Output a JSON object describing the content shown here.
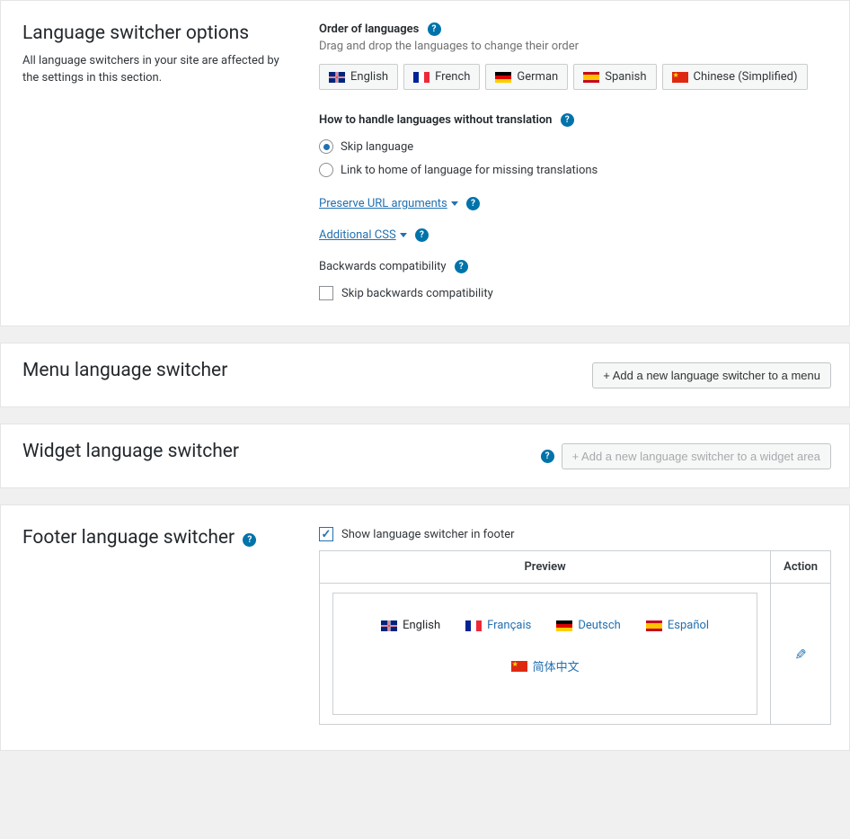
{
  "section1": {
    "title": "Language switcher options",
    "desc": "All language switchers in your site are affected by the settings in this section.",
    "order_label": "Order of languages",
    "order_sub": "Drag and drop the languages to change their order",
    "languages": [
      {
        "name": "English",
        "flag": "gb"
      },
      {
        "name": "French",
        "flag": "fr"
      },
      {
        "name": "German",
        "flag": "de"
      },
      {
        "name": "Spanish",
        "flag": "es"
      },
      {
        "name": "Chinese (Simplified)",
        "flag": "cn"
      }
    ],
    "missing_label": "How to handle languages without translation",
    "radio1": "Skip language",
    "radio2": "Link to home of language for missing translations",
    "preserve_url": "Preserve URL arguments",
    "additional_css": "Additional CSS",
    "back_compat": "Backwards compatibility",
    "skip_back_compat": "Skip backwards compatibility"
  },
  "section2": {
    "title": "Menu language switcher",
    "button": "+ Add a new language switcher to a menu"
  },
  "section3": {
    "title": "Widget language switcher",
    "button": "+ Add a new language switcher to a widget area"
  },
  "section4": {
    "title": "Footer language switcher",
    "checkbox": "Show language switcher in footer",
    "preview_header": "Preview",
    "action_header": "Action",
    "preview_langs": [
      {
        "name": "English",
        "flag": "gb",
        "current": true
      },
      {
        "name": "Français",
        "flag": "fr",
        "current": false
      },
      {
        "name": "Deutsch",
        "flag": "de",
        "current": false
      },
      {
        "name": "Español",
        "flag": "es",
        "current": false
      },
      {
        "name": "简体中文",
        "flag": "cn",
        "current": false
      }
    ]
  }
}
